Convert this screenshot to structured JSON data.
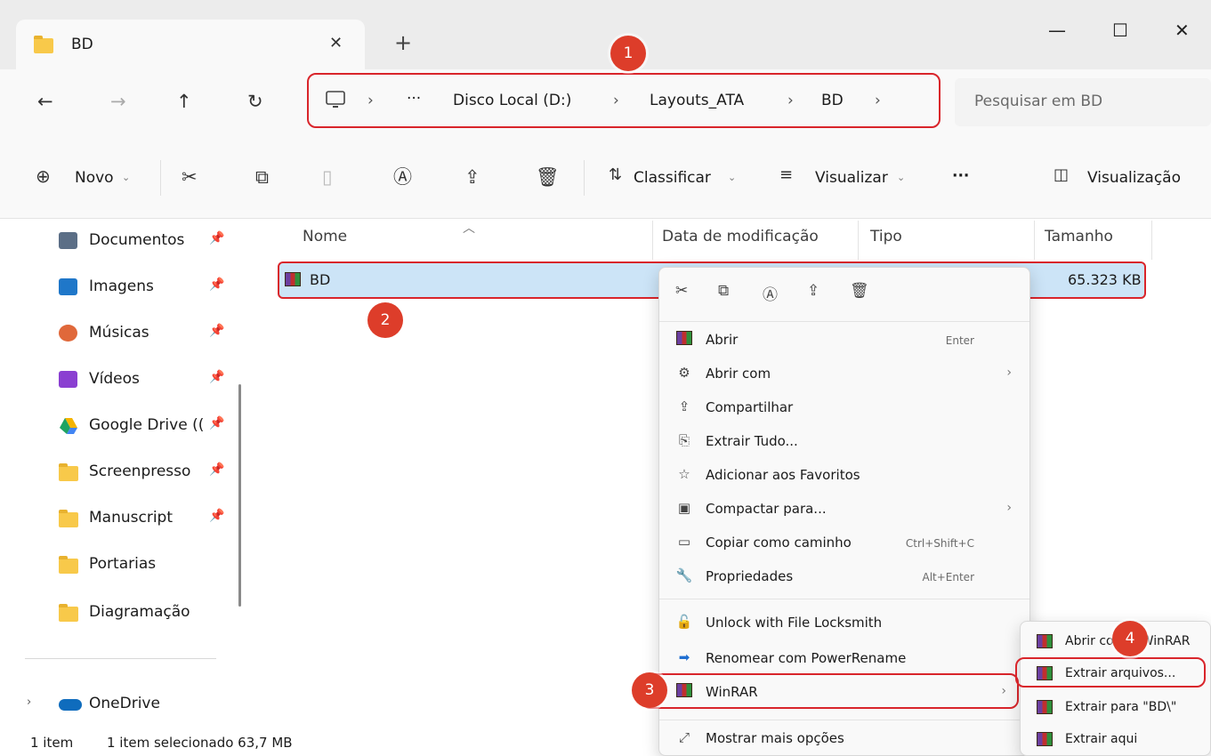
{
  "window": {
    "tab_title": "BD",
    "close_tab": "✕",
    "new_tab": "+",
    "minimize": "—",
    "maximize": "☐",
    "close": "✕"
  },
  "nav": {
    "back": "←",
    "forward": "→",
    "up": "↑",
    "refresh": "↻",
    "breadcrumb": [
      "Disco Local (D:)",
      "Layouts_ATA",
      "BD"
    ],
    "ellipsis": "···",
    "sep": "›",
    "search_placeholder": "Pesquisar em BD"
  },
  "toolbar": {
    "new_label": "Novo",
    "sort_label": "Classificar",
    "view_label": "Visualizar",
    "more": "···",
    "preview_label": "Visualização"
  },
  "sidebar": {
    "items": [
      {
        "label": "Documentos",
        "icon": "documents-icon",
        "color": "#5b6e86"
      },
      {
        "label": "Imagens",
        "icon": "pictures-icon",
        "color": "#1f77c9"
      },
      {
        "label": "Músicas",
        "icon": "music-icon",
        "color": "#e0683a"
      },
      {
        "label": "Vídeos",
        "icon": "videos-icon",
        "color": "#8a3fd1"
      },
      {
        "label": "Google Drive ((",
        "icon": "google-drive-icon",
        "color": "#2f9e44"
      },
      {
        "label": "Screenpresso",
        "icon": "folder-icon",
        "color": "#f8c94a"
      },
      {
        "label": "Manuscript",
        "icon": "folder-icon",
        "color": "#f8c94a"
      },
      {
        "label": "Portarias",
        "icon": "folder-icon",
        "color": "#f8c94a"
      },
      {
        "label": "Diagramação",
        "icon": "folder-icon",
        "color": "#f8c94a"
      }
    ],
    "onedrive": "OneDrive"
  },
  "columns": {
    "name": "Nome",
    "modified": "Data de modificação",
    "type": "Tipo",
    "size": "Tamanho"
  },
  "file": {
    "name": "BD",
    "size": "65.323 KB"
  },
  "context_menu": {
    "items": [
      {
        "label": "Abrir",
        "shortcut": "Enter",
        "icon": "winrar-icon"
      },
      {
        "label": "Abrir com",
        "submenu": true,
        "icon": "open-with-icon"
      },
      {
        "label": "Compartilhar",
        "icon": "share-icon"
      },
      {
        "label": "Extrair Tudo...",
        "icon": "extract-all-icon"
      },
      {
        "label": "Adicionar aos Favoritos",
        "icon": "star-icon"
      },
      {
        "label": "Compactar para...",
        "submenu": true,
        "icon": "compress-icon"
      },
      {
        "label": "Copiar como caminho",
        "shortcut": "Ctrl+Shift+C",
        "icon": "copy-path-icon"
      },
      {
        "label": "Propriedades",
        "shortcut": "Alt+Enter",
        "icon": "properties-icon"
      },
      {
        "label": "Unlock with File Locksmith",
        "icon": "lock-icon"
      },
      {
        "label": "Renomear com PowerRename",
        "icon": "rename-icon"
      },
      {
        "label": "WinRAR",
        "submenu": true,
        "icon": "winrar-icon"
      },
      {
        "label": "Mostrar mais opções",
        "icon": "more-options-icon"
      }
    ]
  },
  "submenu": {
    "items": [
      {
        "label": "Abrir com o WinRAR"
      },
      {
        "label": "Extrair arquivos..."
      },
      {
        "label": "Extrair para \"BD\\\""
      },
      {
        "label": "Extrair aqui"
      }
    ]
  },
  "badges": [
    "1",
    "2",
    "3",
    "4"
  ],
  "status": {
    "count": "1 item",
    "selected": "1 item selecionado  63,7 MB"
  },
  "colors": {
    "highlight": "#d9252b",
    "badge": "#dd3d2a",
    "selection": "#cce4f7"
  }
}
